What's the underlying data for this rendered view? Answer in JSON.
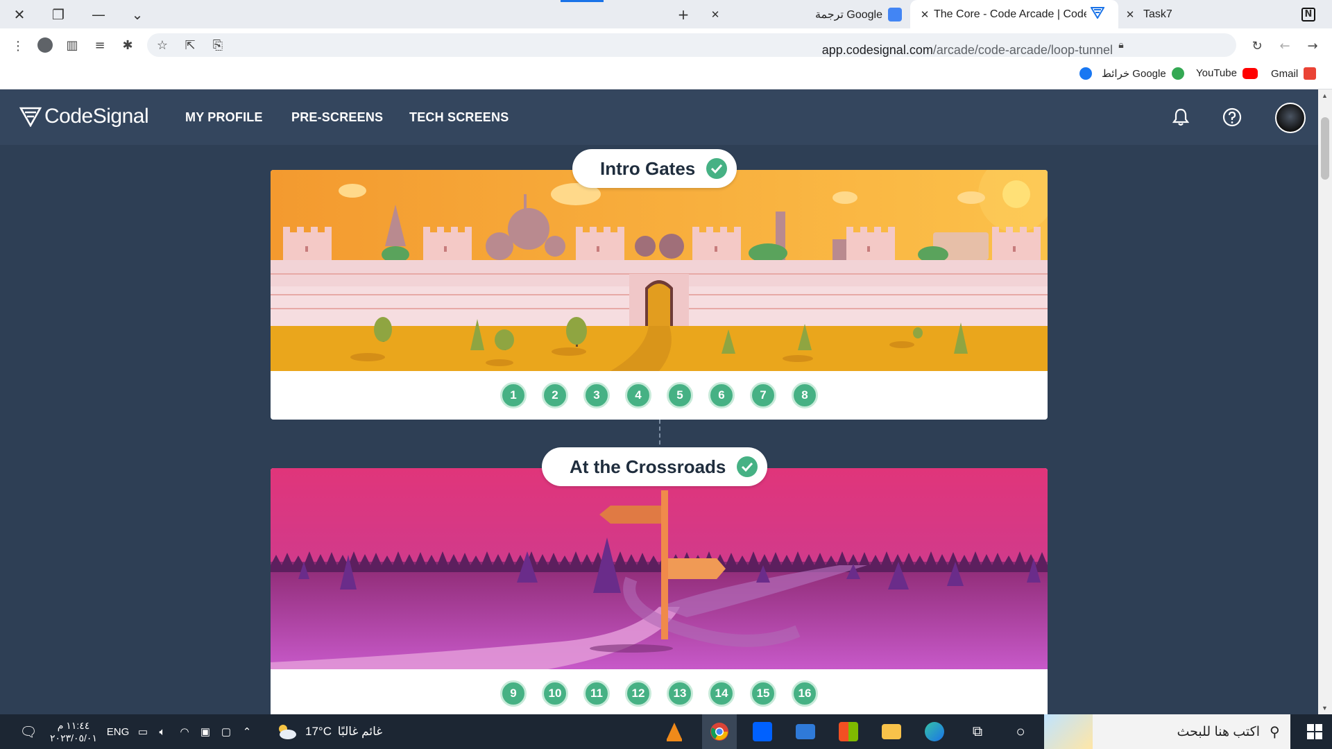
{
  "browser": {
    "tabs": [
      {
        "title": "ترجمة Google",
        "favicon": "google-translate-icon"
      },
      {
        "title": "The Core - Code Arcade | CodeSi",
        "favicon": "codesignal-icon",
        "active": true
      },
      {
        "title": "Task7",
        "favicon": "notion-icon"
      }
    ],
    "url_domain": "app.codesignal.com",
    "url_path": "/arcade/code-arcade/loop-tunnel",
    "bookmarks": [
      {
        "label": "Gmail",
        "icon": "gmail-icon"
      },
      {
        "label": "YouTube",
        "icon": "youtube-icon"
      },
      {
        "label": "خرائط Google",
        "icon": "google-maps-icon"
      }
    ]
  },
  "header": {
    "logo": "CodeSignal",
    "nav": [
      "MY PROFILE",
      "PRE-SCREENS",
      "TECH SCREENS"
    ]
  },
  "areas": [
    {
      "title": "Intro Gates",
      "completed": true,
      "levels": [
        "1",
        "2",
        "3",
        "4",
        "5",
        "6",
        "7",
        "8"
      ]
    },
    {
      "title": "At the Crossroads",
      "completed": true,
      "levels": [
        "9",
        "10",
        "11",
        "12",
        "13",
        "14",
        "15",
        "16"
      ]
    }
  ],
  "colors": {
    "header_bg": "#34465e",
    "page_bg": "#2e3f55",
    "level_green": "#46b184"
  },
  "taskbar": {
    "search_placeholder": "اكتب هنا للبحث",
    "weather_temp": "17°C",
    "weather_text": "غائم غالبًا",
    "language": "ENG",
    "time": "١١:٤٤ م",
    "date": "٢٠٢٣/٠٥/٠١"
  }
}
